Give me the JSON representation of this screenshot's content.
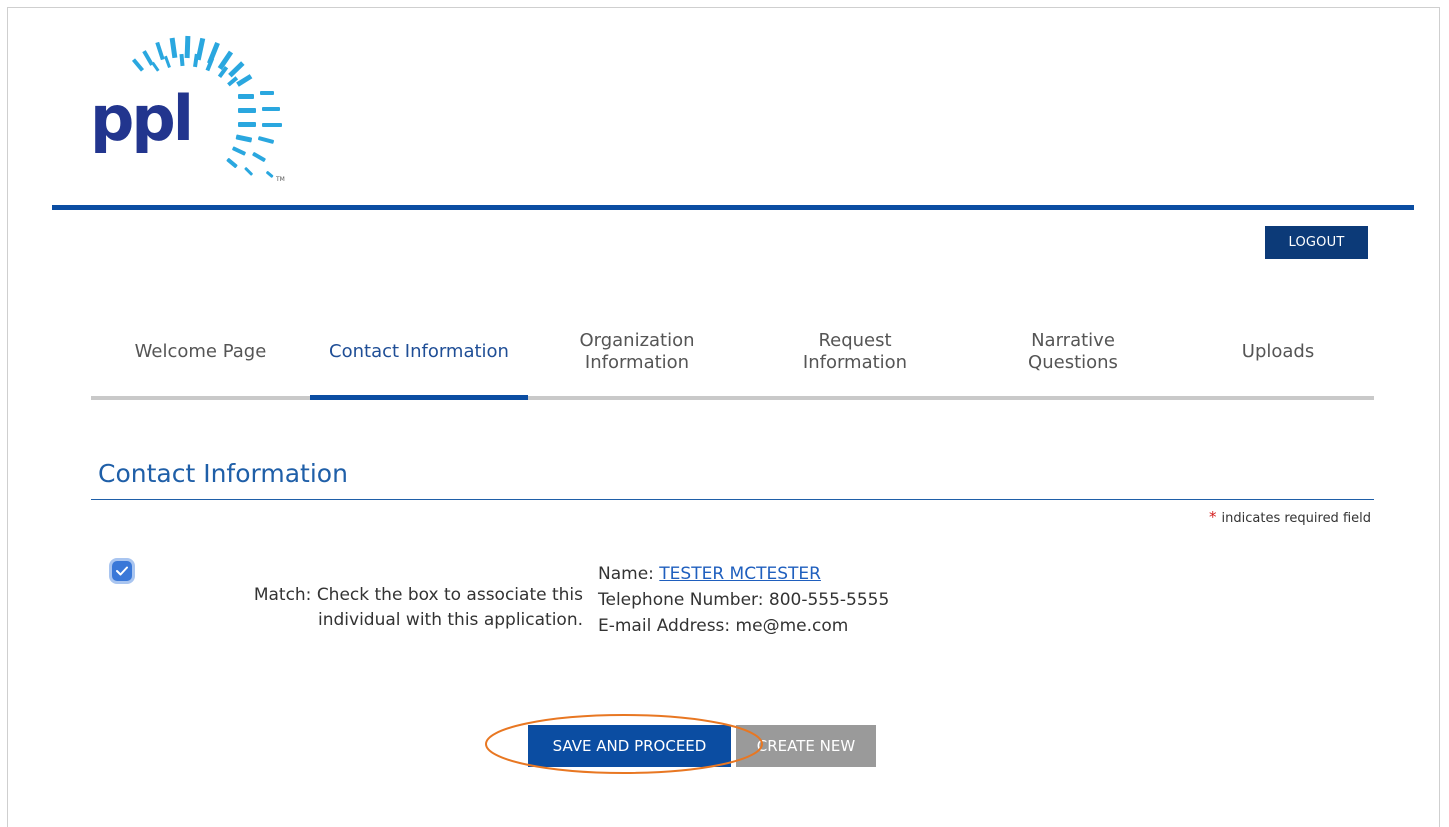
{
  "brand": {
    "logo_text": "ppl",
    "logo_tm": "TM",
    "primary_color": "#0b4da2",
    "dark_color": "#0c3a78",
    "logo_color": "#22358e",
    "ray_color": "#2aa7df"
  },
  "header": {
    "logout_label": "LOGOUT"
  },
  "tabs": [
    {
      "label": "Welcome Page",
      "active": false
    },
    {
      "label": "Contact Information",
      "active": true
    },
    {
      "label": "Organization Information",
      "active": false
    },
    {
      "label": "Request Information",
      "active": false
    },
    {
      "label": "Narrative Questions",
      "active": false
    },
    {
      "label": "Uploads",
      "active": false
    }
  ],
  "section": {
    "title": "Contact Information",
    "required_star": "*",
    "required_note": "indicates required field"
  },
  "match": {
    "checked": true,
    "label": "Match:  Check the box to associate this individual with this application."
  },
  "contact": {
    "name_label": "Name: ",
    "name_value": "TESTER MCTESTER",
    "phone_label": "Telephone Number: ",
    "phone_value": "800-555-5555",
    "email_label": "E-mail Address: ",
    "email_value": "me@me.com"
  },
  "actions": {
    "save_label": "SAVE AND PROCEED",
    "create_label": "CREATE NEW",
    "highlight_color": "#e87722"
  }
}
